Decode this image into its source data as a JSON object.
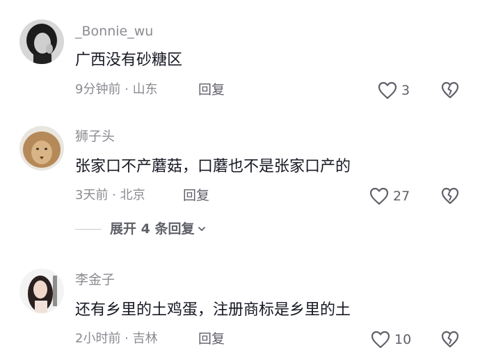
{
  "comments": [
    {
      "username": "_Bonnie_wu",
      "text": "广西没有砂糖区",
      "meta": "9分钟前 · 山东",
      "reply_label": "回复",
      "likes": "3"
    },
    {
      "username": "狮子头",
      "text": "张家口不产蘑菇，口蘑也不是张家口产的",
      "meta": "3天前 · 北京",
      "reply_label": "回复",
      "likes": "27",
      "expand_label": "展开 4 条回复"
    },
    {
      "username": "李金子",
      "text": "还有乡里的土鸡蛋，注册商标是乡里的土",
      "meta": "2小时前 · 吉林",
      "reply_label": "回复",
      "likes": "10"
    }
  ],
  "colors": {
    "text_primary": "#161823",
    "text_secondary": "#8a8b91",
    "icon": "#5f6068"
  },
  "icons": {
    "like": "heart-outline-icon",
    "dislike": "broken-heart-icon",
    "expand": "chevron-down-icon"
  }
}
